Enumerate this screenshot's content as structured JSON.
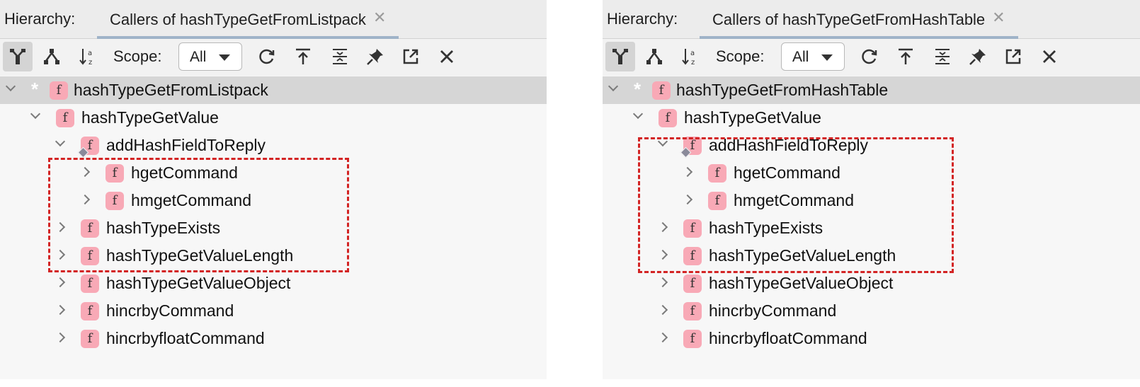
{
  "panels": [
    {
      "hierarchy_label": "Hierarchy:",
      "tab_title": "Callers of hashTypeGetFromListpack",
      "tab_close": "✕",
      "scope_label": "Scope:",
      "scope_value": "All",
      "tree": [
        {
          "label": "hashTypeGetFromListpack",
          "level": 0,
          "state": "expanded",
          "selected": true,
          "root": true
        },
        {
          "label": "hashTypeGetValue",
          "level": 1,
          "state": "expanded"
        },
        {
          "label": "addHashFieldToReply",
          "level": 2,
          "state": "expanded",
          "linked": true
        },
        {
          "label": "hgetCommand",
          "level": 3,
          "state": "collapsed"
        },
        {
          "label": "hmgetCommand",
          "level": 3,
          "state": "collapsed"
        },
        {
          "label": "hashTypeExists",
          "level": 2,
          "state": "collapsed"
        },
        {
          "label": "hashTypeGetValueLength",
          "level": 2,
          "state": "collapsed"
        },
        {
          "label": "hashTypeGetValueObject",
          "level": 2,
          "state": "collapsed"
        },
        {
          "label": "hincrbyCommand",
          "level": 2,
          "state": "collapsed"
        },
        {
          "label": "hincrbyfloatCommand",
          "level": 2,
          "state": "collapsed"
        }
      ]
    },
    {
      "hierarchy_label": "Hierarchy:",
      "tab_title": "Callers of hashTypeGetFromHashTable",
      "tab_close": "✕",
      "scope_label": "Scope:",
      "scope_value": "All",
      "tree": [
        {
          "label": "hashTypeGetFromHashTable",
          "level": 0,
          "state": "expanded",
          "selected": true,
          "root": true
        },
        {
          "label": "hashTypeGetValue",
          "level": 1,
          "state": "expanded"
        },
        {
          "label": "addHashFieldToReply",
          "level": 2,
          "state": "expanded",
          "linked": true
        },
        {
          "label": "hgetCommand",
          "level": 3,
          "state": "collapsed"
        },
        {
          "label": "hmgetCommand",
          "level": 3,
          "state": "collapsed"
        },
        {
          "label": "hashTypeExists",
          "level": 2,
          "state": "collapsed"
        },
        {
          "label": "hashTypeGetValueLength",
          "level": 2,
          "state": "collapsed"
        },
        {
          "label": "hashTypeGetValueObject",
          "level": 2,
          "state": "collapsed"
        },
        {
          "label": "hincrbyCommand",
          "level": 2,
          "state": "collapsed"
        },
        {
          "label": "hincrbyfloatCommand",
          "level": 2,
          "state": "collapsed"
        }
      ]
    }
  ],
  "function_icon_letter": "f",
  "root_marker": "*",
  "toolbar_icons": [
    "caller-hierarchy-icon",
    "callee-hierarchy-icon",
    "sort-alphabetically-icon",
    "refresh-icon",
    "export-icon",
    "expand-all-icon",
    "pin-icon",
    "open-in-new-icon",
    "close-icon"
  ],
  "colors": {
    "function_icon_bg": "#f8a9b6",
    "highlight_border": "#d32424",
    "selected_row": "#d6d6d6",
    "tab_underline": "#9fb3c8"
  }
}
